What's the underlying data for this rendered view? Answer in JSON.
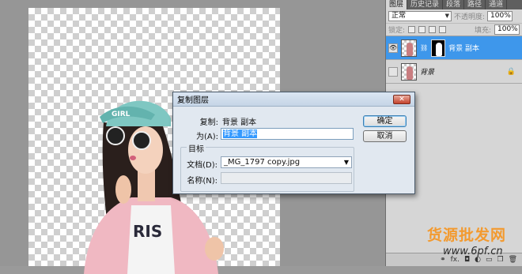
{
  "panel": {
    "tabs": [
      "图层",
      "历史记录",
      "段落",
      "路径",
      "通道"
    ],
    "blend_mode": "正常",
    "opacity_label": "不透明度:",
    "opacity_value": "100%",
    "lock_label": "锁定:",
    "fill_label": "填充:",
    "fill_value": "100%",
    "layers": [
      {
        "name": "背景 副本",
        "selected": true
      },
      {
        "name": "背景",
        "selected": false
      }
    ],
    "footer_icons": [
      "link-icon",
      "fx-icon",
      "mask-icon",
      "adjustment-icon",
      "folder-icon",
      "new-layer-icon",
      "trash-icon"
    ]
  },
  "dialog": {
    "title": "复制图层",
    "duplicate_label": "复制:",
    "duplicate_value": "背景 副本",
    "as_label": "为(A):",
    "as_value": "背景 副本",
    "destination_legend": "目标",
    "document_label": "文档(D):",
    "document_value": "_MG_1797 copy.jpg",
    "name_label": "名称(N):",
    "ok_label": "确定",
    "cancel_label": "取消"
  },
  "watermark": {
    "text": "货源批发网",
    "url": "www.6pf.cn"
  },
  "colors": {
    "selection": "#3e97eb",
    "watermark": "#f39a2f"
  }
}
